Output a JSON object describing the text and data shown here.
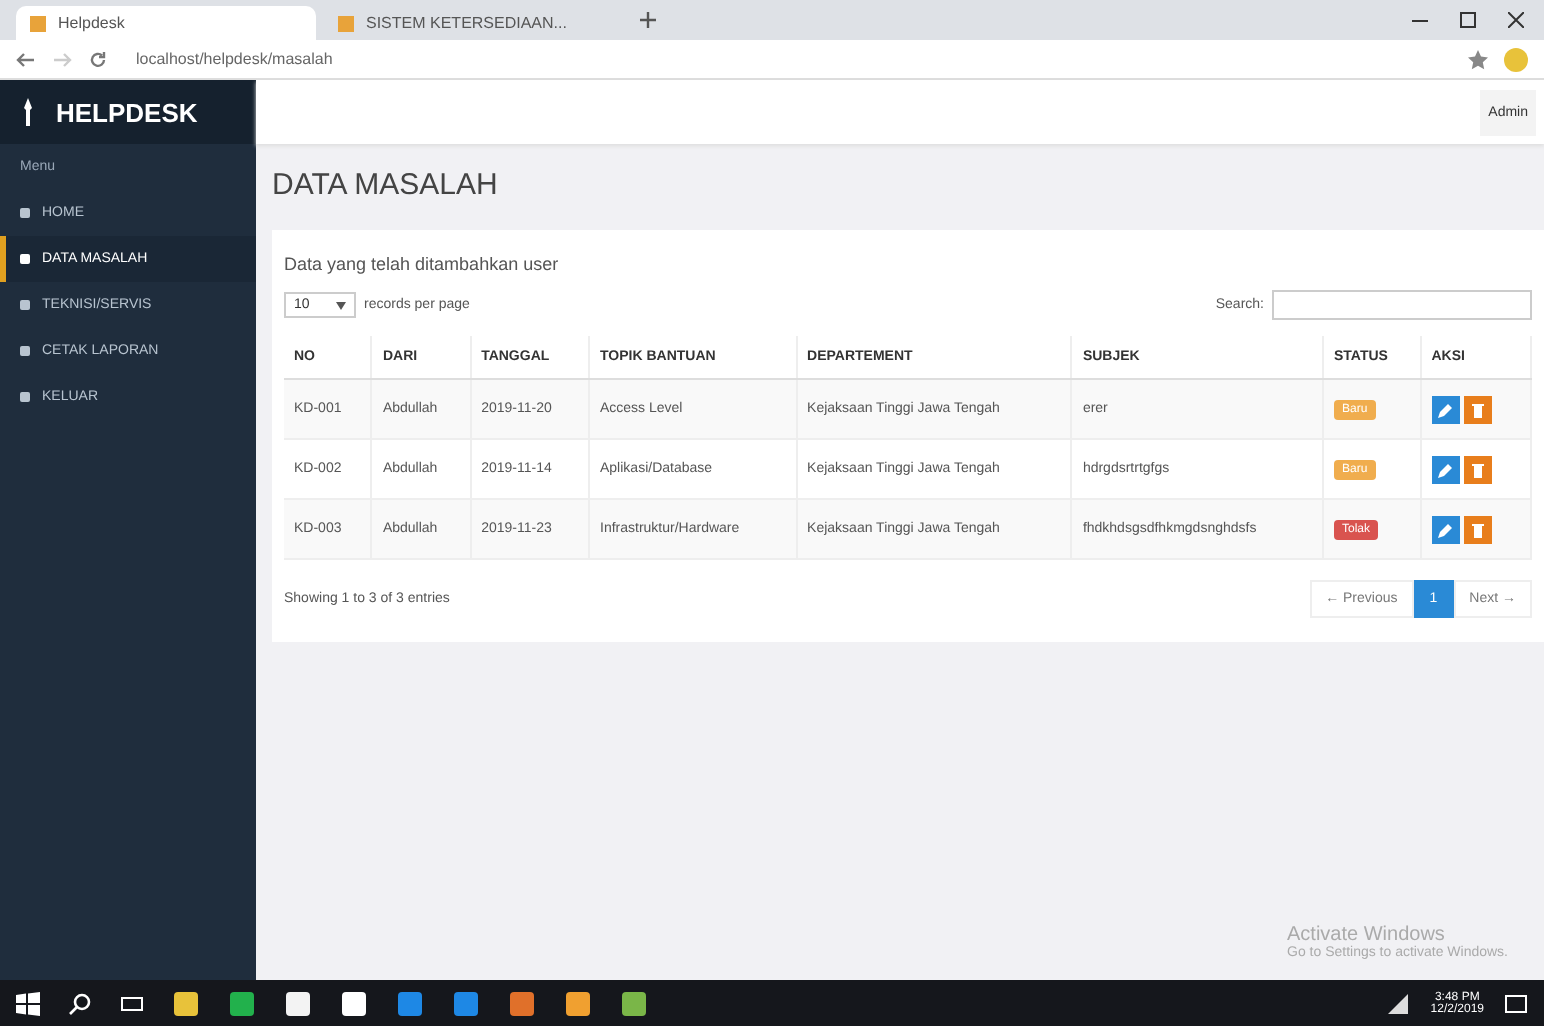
{
  "browser": {
    "tabs": [
      {
        "title": "Helpdesk",
        "selected": true
      },
      {
        "title": "SISTEM KETERSEDIAAN...",
        "selected": false
      }
    ],
    "address": "localhost/helpdesk/masalah"
  },
  "sidebar": {
    "brand": "HELPDESK",
    "heading": "Menu",
    "items": [
      {
        "label": "HOME",
        "selected": false
      },
      {
        "label": "DATA MASALAH",
        "selected": true
      },
      {
        "label": "TEKNISI/SERVIS",
        "selected": false
      },
      {
        "label": "CETAK LAPORAN",
        "selected": false
      },
      {
        "label": "KELUAR",
        "selected": false
      }
    ]
  },
  "header": {
    "user": "Admin"
  },
  "page_title": "DATA MASALAH",
  "card": {
    "title": "Data yang telah ditambahkan user",
    "page_size": "10",
    "page_size_label": "records per page",
    "search_label": "Search:",
    "table": {
      "columns": [
        "NO",
        "DARI",
        "TANGGAL",
        "TOPIK BANTUAN",
        "DEPARTEMENT",
        "SUBJEK",
        "STATUS",
        "AKSI"
      ],
      "rows": [
        {
          "no": "KD-001",
          "dari": "Abdullah",
          "tanggal": "2019-11-20",
          "topik": "Access Level",
          "departement": "Kejaksaan Tinggi Jawa Tengah",
          "subjek": "erer",
          "status": "Baru",
          "color": "#f0ad4e"
        },
        {
          "no": "KD-002",
          "dari": "Abdullah",
          "tanggal": "2019-11-14",
          "topik": "Aplikasi/Database",
          "departement": "Kejaksaan Tinggi Jawa Tengah",
          "subjek": "hdrgdsrtrtgfgs",
          "status": "Baru",
          "color": "#f0ad4e"
        },
        {
          "no": "KD-003",
          "dari": "Abdullah",
          "tanggal": "2019-11-23",
          "topik": "Infrastruktur/Hardware",
          "departement": "Kejaksaan Tinggi Jawa Tengah",
          "subjek": "fhdkhdsgsdfhkmgdsnghdsfs",
          "status": "Tolak",
          "color": "#d9534f"
        }
      ]
    },
    "info": "Showing 1 to 3 of 3 entries",
    "pager": [
      {
        "label": "← Previous",
        "selected": false
      },
      {
        "label": "1",
        "selected": true
      },
      {
        "label": "Next →",
        "selected": false
      }
    ]
  },
  "activation": {
    "title": "Activate Windows",
    "text": "Go to Settings to activate Windows."
  },
  "taskbar": {
    "time": "3:48 PM",
    "date": "12/2/2019"
  }
}
